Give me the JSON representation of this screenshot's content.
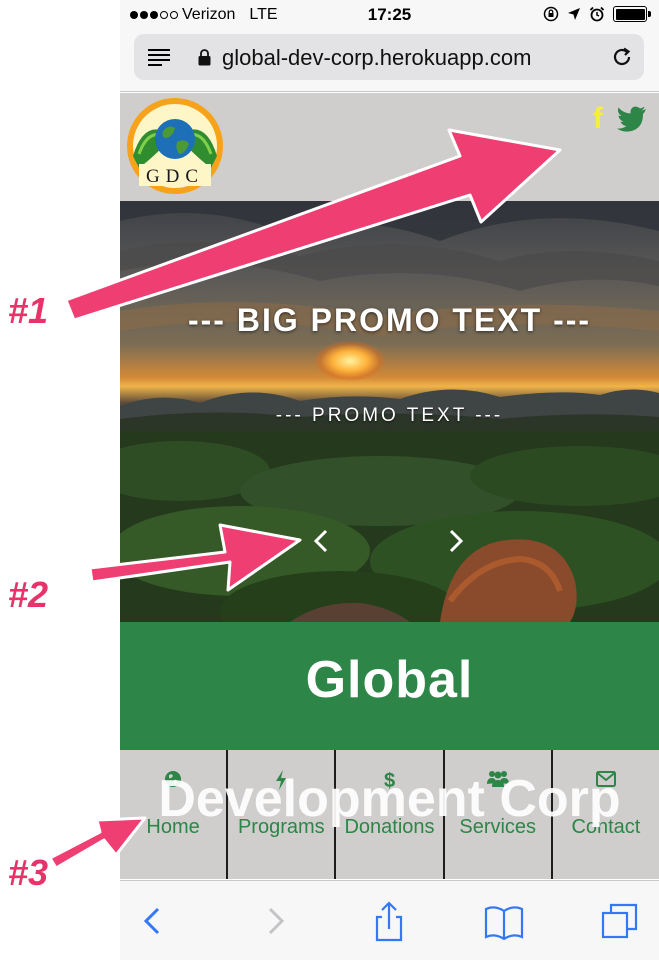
{
  "status_bar": {
    "carrier": "Verizon",
    "network": "LTE",
    "time": "17:25"
  },
  "browser": {
    "url": "global-dev-corp.herokuapp.com"
  },
  "header": {
    "logo_text": "GDC",
    "social": [
      "facebook-icon",
      "twitter-icon"
    ]
  },
  "hero": {
    "big_promo": "--- BIG PROMO TEXT ---",
    "small_promo": "--- PROMO TEXT ---"
  },
  "site_title": {
    "line1": "Global",
    "line2": "Development Corp"
  },
  "nav": {
    "items": [
      {
        "label": "Home",
        "icon": "globe-icon"
      },
      {
        "label": "Programs",
        "icon": "bolt-icon"
      },
      {
        "label": "Donations",
        "icon": "dollar-icon"
      },
      {
        "label": "Services",
        "icon": "users-icon"
      },
      {
        "label": "Contact",
        "icon": "envelope-icon"
      }
    ]
  },
  "annotations": {
    "label1": "#1",
    "label2": "#2",
    "label3": "#3"
  },
  "colors": {
    "brand_green": "#2d8647",
    "annotation_pink": "#e8336a",
    "facebook_yellow": "#f4f03a",
    "page_gray": "#d0cdcd"
  }
}
